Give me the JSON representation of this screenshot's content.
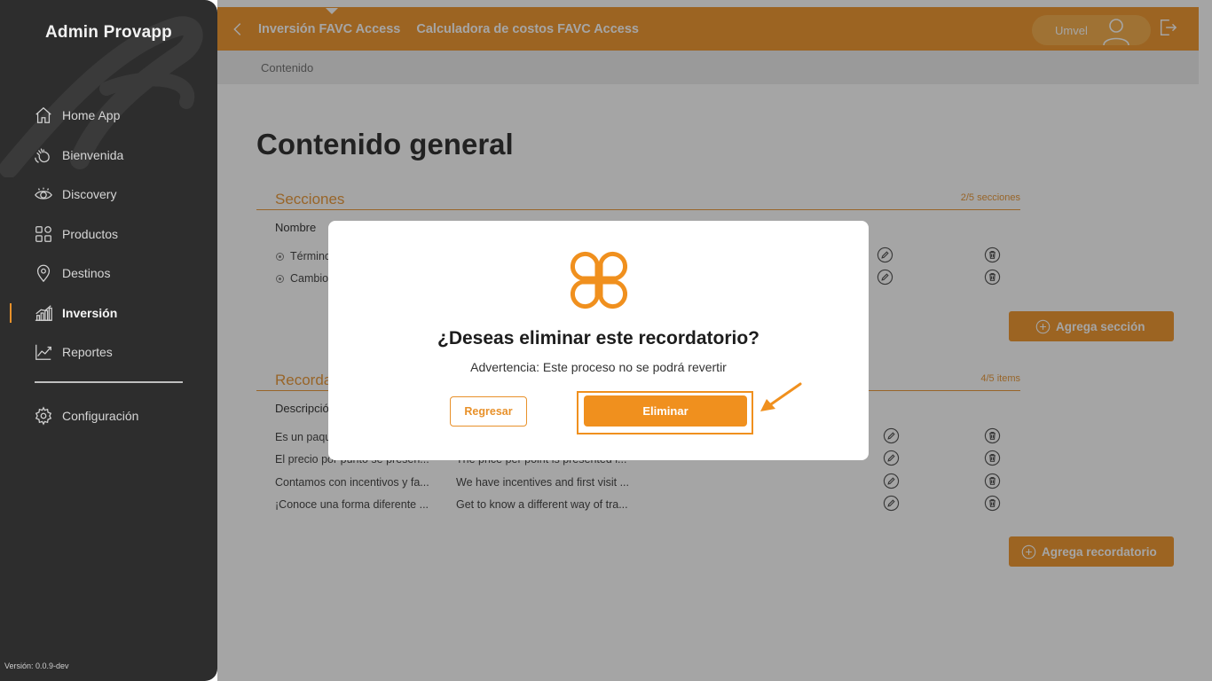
{
  "sidebar": {
    "brand": "Admin Provapp",
    "items": [
      {
        "label": "Home App",
        "icon": "home-icon"
      },
      {
        "label": "Bienvenida",
        "icon": "wave-hand-icon"
      },
      {
        "label": "Discovery",
        "icon": "eye-icon"
      },
      {
        "label": "Productos",
        "icon": "grid-icon"
      },
      {
        "label": "Destinos",
        "icon": "location-pin-icon"
      },
      {
        "label": "Inversión",
        "icon": "bar-chart-icon",
        "active": true
      },
      {
        "label": "Reportes",
        "icon": "line-chart-icon"
      }
    ],
    "config_label": "Configuración",
    "version": "Versión: 0.0.9-dev"
  },
  "header": {
    "tabs": [
      "Inversión FAVC Access",
      "Calculadora de costos FAVC Access"
    ],
    "user_name": "Umvel"
  },
  "breadcrumb": "Contenido",
  "page_title": "Contenido general",
  "sections": {
    "title": "Secciones",
    "count": "2/5 secciones",
    "column": "Nombre",
    "rows": [
      "Términos",
      "Cambio"
    ],
    "add_label": "Agrega sección"
  },
  "reminders": {
    "title": "Recordatorios",
    "count": "4/5 items",
    "column": "Descripción",
    "rows": [
      {
        "es": "Es un paquete...",
        "en": ""
      },
      {
        "es": "El precio por punto se presen...",
        "en": "The price per point is presented i..."
      },
      {
        "es": "Contamos con incentivos y fa...",
        "en": "We have incentives and first visit ..."
      },
      {
        "es": "¡Conoce una forma diferente ...",
        "en": "Get to know a different way of tra..."
      }
    ],
    "add_label": "Agrega recordatorio"
  },
  "modal": {
    "title": "¿Deseas eliminar este recordatorio?",
    "warning": "Advertencia: Este proceso no se podrá revertir",
    "back_label": "Regresar",
    "delete_label": "Eliminar"
  },
  "colors": {
    "accent": "#f0901e",
    "sidebar_bg": "#2d2d2d"
  }
}
